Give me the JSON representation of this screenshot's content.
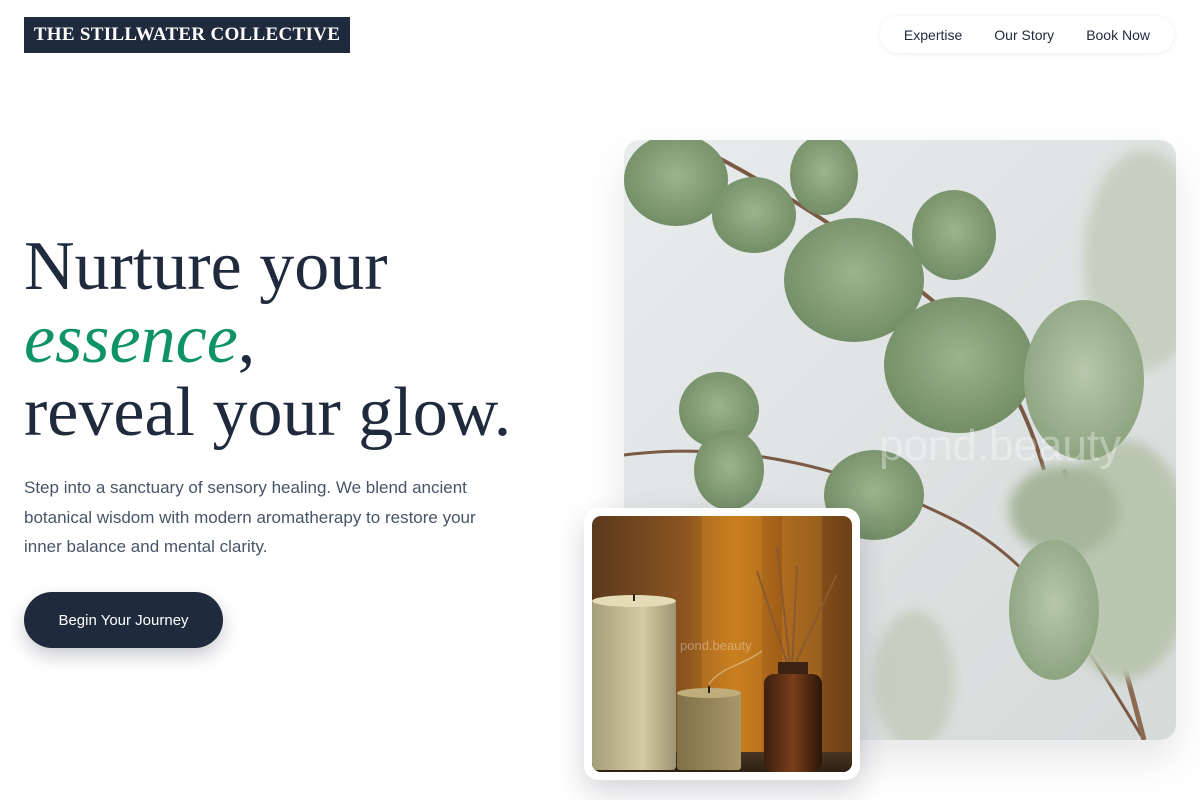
{
  "brand": {
    "name": "THE STILLWATER COLLECTIVE"
  },
  "nav": {
    "items": [
      {
        "label": "Expertise"
      },
      {
        "label": "Our Story"
      },
      {
        "label": "Book Now"
      }
    ]
  },
  "hero": {
    "headline": {
      "line1": "Nurture your",
      "accent": "essence",
      "accent_suffix": ",",
      "line3": "reveal your glow."
    },
    "body": "Step into a sanctuary of sensory healing. We blend ancient botanical wisdom with modern aromatherapy to restore your inner balance and mental clarity.",
    "cta_label": "Begin Your Journey"
  },
  "images": {
    "main": {
      "subject": "eucalyptus-branch-photo",
      "watermark": "pond.beauty"
    },
    "card": {
      "subject": "candles-and-reed-diffuser-photo",
      "watermark": "pond.beauty"
    }
  },
  "colors": {
    "navy": "#1f2a3c",
    "accent_green": "#0e9267",
    "body_text": "#475569",
    "background": "#ffffff"
  }
}
